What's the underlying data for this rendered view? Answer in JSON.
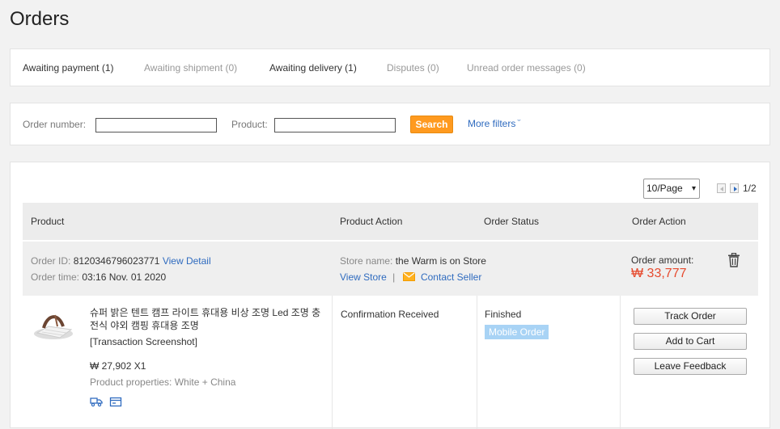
{
  "page": {
    "title": "Orders"
  },
  "tabs": [
    {
      "label": "Awaiting payment (1)",
      "active": true
    },
    {
      "label": "Awaiting shipment (0)",
      "active": false
    },
    {
      "label": "Awaiting delivery (1)",
      "active": true
    },
    {
      "label": "Disputes (0)",
      "active": false
    },
    {
      "label": "Unread order messages (0)",
      "active": false
    }
  ],
  "filters": {
    "order_number_label": "Order number:",
    "order_number_value": "",
    "product_label": "Product:",
    "product_value": "",
    "search_label": "Search",
    "more_filters_label": "More filters",
    "more_filters_icon": "chevron-down-icon"
  },
  "pagination": {
    "page_size": "10/Page",
    "page_count": "1/2",
    "prev_icon": "triangle-left-icon",
    "next_icon": "triangle-right-icon"
  },
  "table": {
    "headers": [
      "Product",
      "Product Action",
      "Order Status",
      "Order Action"
    ]
  },
  "order": {
    "id_label": "Order ID:",
    "id_value": "8120346796023771",
    "view_detail": "View Detail",
    "time_label": "Order time:",
    "time_value": "03:16 Nov. 01 2020",
    "store_label": "Store name:",
    "store_value": "the Warm is on Store",
    "view_store": "View Store",
    "separator": "|",
    "contact_seller": "Contact Seller",
    "contact_icon": "envelope-icon",
    "amount_label": "Order amount:",
    "amount_value": "₩ 33,777",
    "delete_icon": "trash-icon",
    "product": {
      "name": "슈퍼 밝은 텐트 캠프 라이트 휴대용 비상 조명 Led 조명 충전식 야외 캠핑 휴대용 조명",
      "note": "[Transaction Screenshot]",
      "price_qty": "₩ 27,902 X1",
      "properties": "Product properties: White + China",
      "icons": [
        "truck-icon",
        "card-icon"
      ]
    },
    "product_action": "Confirmation Received",
    "status": "Finished",
    "badge": "Mobile Order",
    "actions": [
      "Track Order",
      "Add to Cart",
      "Leave Feedback"
    ]
  },
  "colors": {
    "accent_link": "#2f6bbf",
    "search_button": "#ff9a1f",
    "amount": "#e64a2e",
    "badge": "#a8d3f5"
  }
}
